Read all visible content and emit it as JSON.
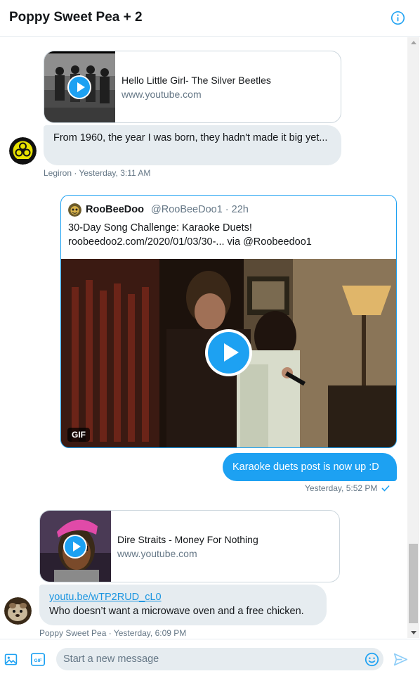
{
  "header": {
    "title": "Poppy Sweet Pea + 2",
    "info_icon": "info-circle-icon"
  },
  "messages": {
    "beatles_card": {
      "title": "Hello Little Girl- The Silver Beetles",
      "domain": "www.youtube.com"
    },
    "legiron_text": "From 1960, the year I was born, they hadn't made it big yet...",
    "legiron_meta": {
      "sender": "Legiron",
      "time": "Yesterday, 3:11 AM"
    },
    "tweet": {
      "name": "RooBeeDoo",
      "handle": "@RooBeeDoo1 · 22h",
      "text_line1": "30-Day Song Challenge: Karaoke Duets!",
      "text_line2": "roobeedoo2.com/2020/01/03/30-... via @Roobeedoo1",
      "gif_badge": "GIF"
    },
    "outgoing_text": "Karaoke duets post is now up :D",
    "outgoing_meta": "Yesterday, 5:52 PM",
    "dire_card": {
      "title": "Dire Straits - Money For Nothing",
      "domain": "www.youtube.com"
    },
    "poppy_link": "youtu.be/wTP2RUD_cL0",
    "poppy_text": "Who doesn’t want a microwave oven and a free chicken.",
    "poppy_meta": {
      "sender": "Poppy Sweet Pea",
      "time": "Yesterday, 6:09 PM"
    }
  },
  "composer": {
    "placeholder": "Start a new message",
    "icons": [
      "image-icon",
      "gif-icon",
      "emoji-icon",
      "send-icon"
    ]
  },
  "colors": {
    "accent": "#1da1f2",
    "bubble_in": "#e6ecf0",
    "meta_text": "#657786"
  }
}
